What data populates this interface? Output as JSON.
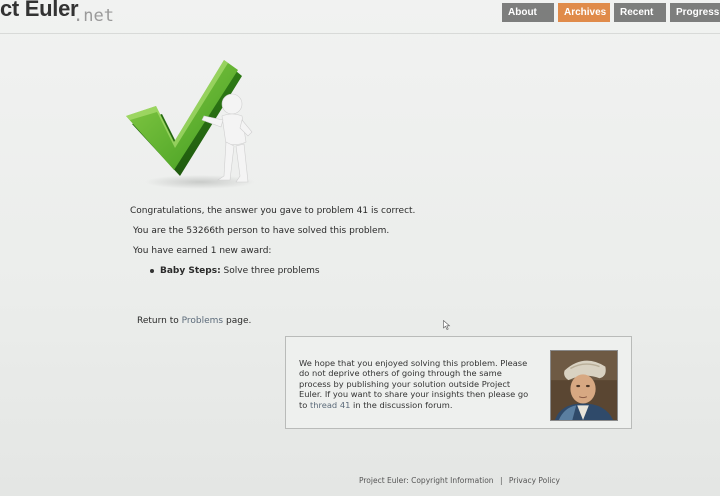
{
  "header": {
    "logo_main": "ct Euler",
    "logo_suffix": ".net",
    "nav": [
      {
        "label": "About",
        "active": false
      },
      {
        "label": "Archives",
        "active": true
      },
      {
        "label": "Recent",
        "active": false
      },
      {
        "label": "Progress",
        "active": false
      }
    ],
    "accent_color": "#e08b4a",
    "nav_color": "#7d7e7d"
  },
  "hero": {
    "icon": "green-checkmark-with-figure-icon"
  },
  "messages": {
    "congrats": "Congratulations, the answer you gave to problem 41 is correct.",
    "solver_count": "You are the 53266th person to have solved this problem.",
    "earned": "You have earned 1 new award:",
    "award_name": "Baby Steps:",
    "award_desc": "Solve three problems"
  },
  "return": {
    "prefix": "Return to",
    "link": "Problems",
    "suffix": "page."
  },
  "infobox": {
    "text_before_link": "We hope that you enjoyed solving this problem. Please do not deprive others of going through the same process by publishing your solution outside Project Euler. If you want to share your insights then please go to",
    "link": "thread 41",
    "text_after_link": "in the discussion forum.",
    "portrait": "euler-portrait-image"
  },
  "footer": {
    "prefix": "Project Euler:",
    "copyright": "Copyright Information",
    "separator": "|",
    "privacy": "Privacy Policy"
  }
}
